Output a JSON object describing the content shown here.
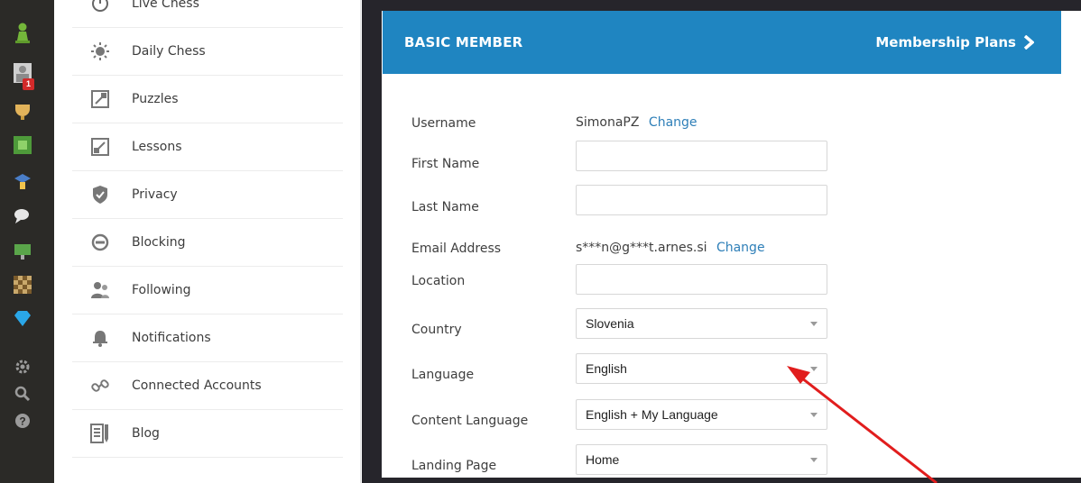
{
  "rail": {
    "badge": "1",
    "icons": [
      "pawn-icon",
      "profile-icon",
      "trophy-icon",
      "puzzle-icon",
      "lesson-icon",
      "chat-icon",
      "screen-icon",
      "board-icon",
      "diamond-icon",
      "settings-icon",
      "search-icon",
      "help-icon"
    ]
  },
  "menu": {
    "items": [
      {
        "label": "Live Chess",
        "icon": "clock-icon"
      },
      {
        "label": "Daily Chess",
        "icon": "sun-icon"
      },
      {
        "label": "Puzzles",
        "icon": "puzzle-piece-icon"
      },
      {
        "label": "Lessons",
        "icon": "lessons-icon"
      },
      {
        "label": "Privacy",
        "icon": "shield-icon"
      },
      {
        "label": "Blocking",
        "icon": "block-icon"
      },
      {
        "label": "Following",
        "icon": "people-icon"
      },
      {
        "label": "Notifications",
        "icon": "bell-icon"
      },
      {
        "label": "Connected Accounts",
        "icon": "link-icon"
      },
      {
        "label": "Blog",
        "icon": "blog-icon"
      }
    ]
  },
  "header": {
    "title": "BASIC MEMBER",
    "link": "Membership Plans"
  },
  "form": {
    "username": {
      "label": "Username",
      "value": "SimonaPZ",
      "action": "Change"
    },
    "first_name": {
      "label": "First Name",
      "value": ""
    },
    "last_name": {
      "label": "Last Name",
      "value": ""
    },
    "email": {
      "label": "Email Address",
      "value": "s***n@g***t.arnes.si",
      "action": "Change"
    },
    "location": {
      "label": "Location",
      "value": ""
    },
    "country": {
      "label": "Country",
      "value": "Slovenia"
    },
    "language": {
      "label": "Language",
      "value": "English"
    },
    "content_language": {
      "label": "Content Language",
      "value": "English + My Language"
    },
    "landing_page": {
      "label": "Landing Page",
      "value": "Home"
    }
  },
  "colors": {
    "header_bg": "#1f85c1",
    "link": "#2e7fb8",
    "rail_bg": "#2b2a27",
    "annotation": "#e11d1d"
  }
}
